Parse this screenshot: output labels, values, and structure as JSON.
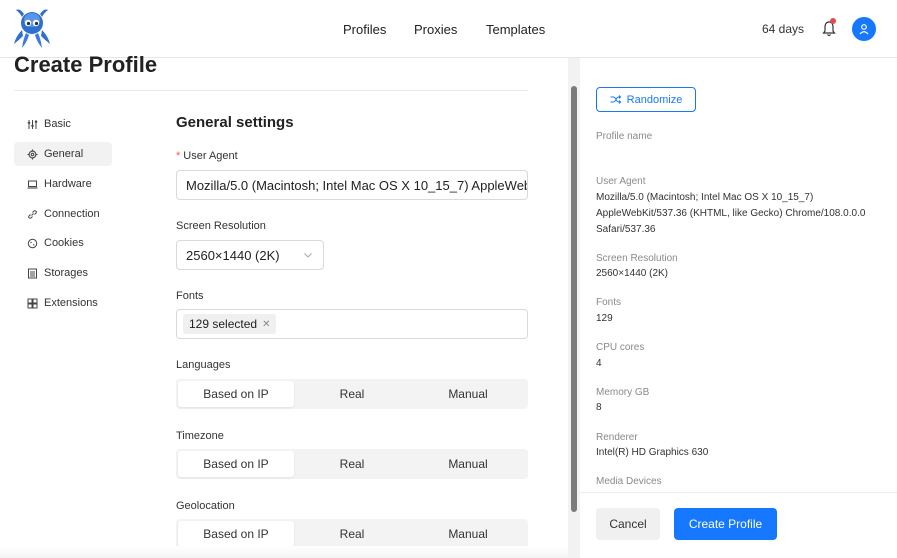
{
  "topnav": {
    "items": [
      "Profiles",
      "Proxies",
      "Templates"
    ],
    "days_label": "64 days"
  },
  "page": {
    "title": "Create Profile"
  },
  "sidebar": {
    "items": [
      {
        "label": "Basic",
        "icon": "sliders-icon"
      },
      {
        "label": "General",
        "icon": "gear-icon"
      },
      {
        "label": "Hardware",
        "icon": "laptop-icon"
      },
      {
        "label": "Connection",
        "icon": "link-icon"
      },
      {
        "label": "Cookies",
        "icon": "cookie-icon"
      },
      {
        "label": "Storages",
        "icon": "storage-icon"
      },
      {
        "label": "Extensions",
        "icon": "extensions-icon"
      }
    ],
    "active": "General"
  },
  "general": {
    "section_title": "General settings",
    "user_agent": {
      "required_mark": "*",
      "label": "User Agent",
      "value": "Mozilla/5.0 (Macintosh; Intel Mac OS X 10_15_7) AppleWeb"
    },
    "screen_resolution": {
      "label": "Screen Resolution",
      "value": "2560×1440 (2K)"
    },
    "fonts": {
      "label": "Fonts",
      "tag": "129 selected"
    },
    "languages": {
      "label": "Languages",
      "options": [
        "Based on IP",
        "Real",
        "Manual"
      ],
      "selected": "Based on IP"
    },
    "timezone": {
      "label": "Timezone",
      "options": [
        "Based on IP",
        "Real",
        "Manual"
      ],
      "selected": "Based on IP"
    },
    "geolocation": {
      "label": "Geolocation",
      "options": [
        "Based on IP",
        "Real",
        "Manual"
      ],
      "selected": "Based on IP"
    }
  },
  "summary": {
    "randomize_label": "Randomize",
    "profile_name_label": "Profile name",
    "user_agent_label": "User Agent",
    "user_agent_value": "Mozilla/5.0 (Macintosh; Intel Mac OS X 10_15_7) AppleWebKit/537.36 (KHTML, like Gecko) Chrome/108.0.0.0 Safari/537.36",
    "screen_resolution_label": "Screen Resolution",
    "screen_resolution_value": "2560×1440 (2K)",
    "fonts_label": "Fonts",
    "fonts_value": "129",
    "cpu_label": "CPU cores",
    "cpu_value": "4",
    "memory_label": "Memory GB",
    "memory_value": "8",
    "renderer_label": "Renderer",
    "renderer_value": "Intel(R) HD Graphics 630",
    "media_label": "Media Devices"
  },
  "footer": {
    "cancel_label": "Cancel",
    "create_label": "Create Profile"
  },
  "colors": {
    "accent": "#1677ff",
    "notification": "#e5484d"
  }
}
